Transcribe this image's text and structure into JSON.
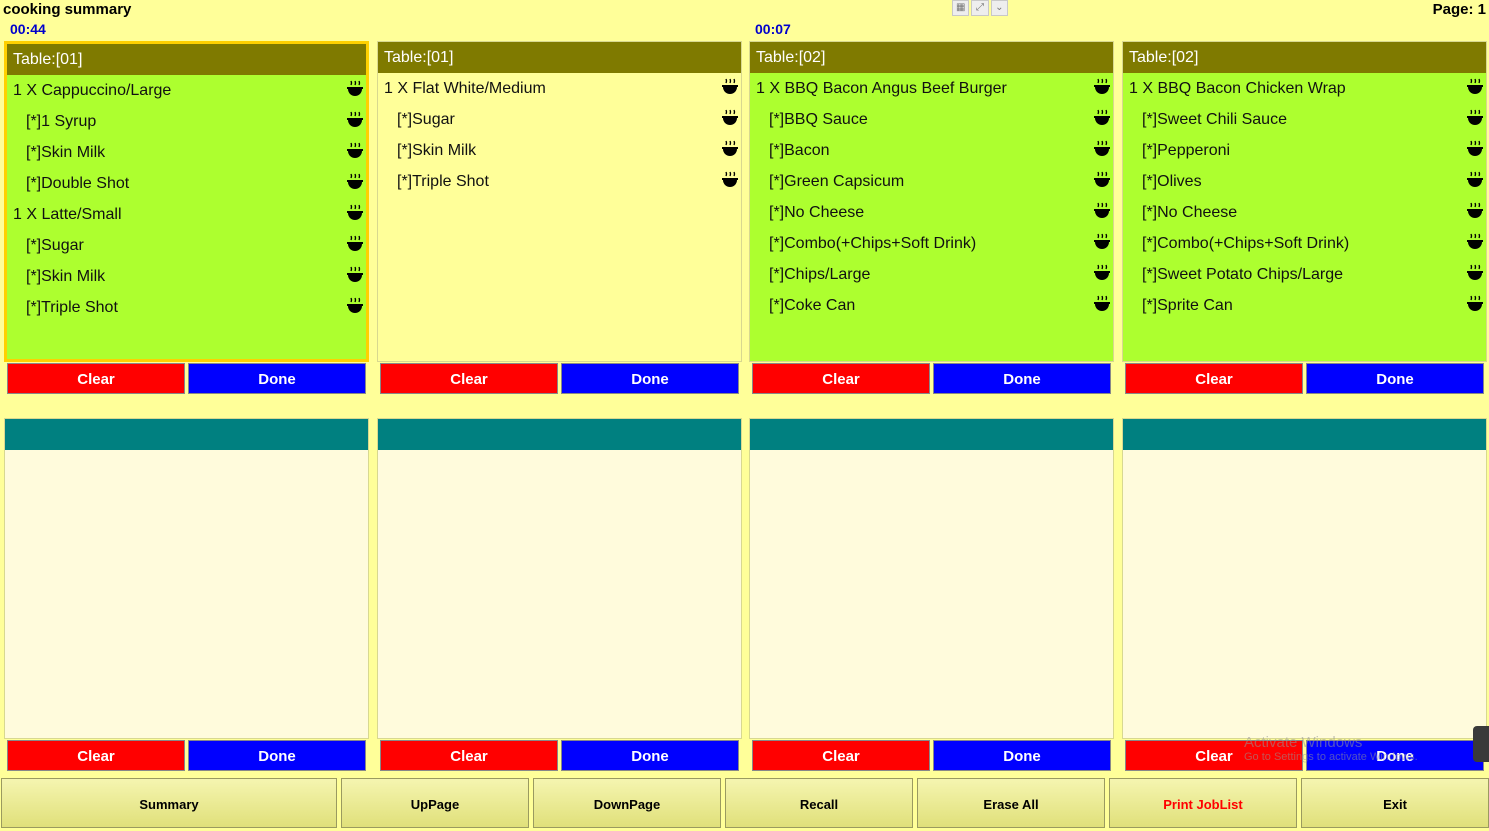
{
  "header": {
    "title": "cooking summary",
    "page_label": "Page:  1"
  },
  "panels": [
    {
      "timer": "00:44",
      "table": "Table:[01]",
      "items": [
        "1 X  Cappuccino/Large",
        "[*]1 Syrup",
        "[*]Skin Milk",
        "[*]Double Shot",
        "1 X  Latte/Small",
        "[*]Sugar",
        "[*]Skin Milk",
        "[*]Triple Shot"
      ],
      "clear": "Clear",
      "done": "Done"
    },
    {
      "timer": "",
      "table": "Table:[01]",
      "items": [
        "1 X  Flat White/Medium",
        "[*]Sugar",
        "[*]Skin Milk",
        "[*]Triple Shot"
      ],
      "clear": "Clear",
      "done": "Done"
    },
    {
      "timer": "00:07",
      "table": "Table:[02]",
      "items": [
        "1 X  BBQ Bacon Angus Beef Burger",
        "[*]BBQ Sauce",
        "[*]Bacon",
        "[*]Green Capsicum",
        "[*]No Cheese",
        "[*]Combo(+Chips+Soft Drink)",
        "[*]Chips/Large",
        "[*]Coke Can"
      ],
      "clear": "Clear",
      "done": "Done"
    },
    {
      "timer": "",
      "table": "Table:[02]",
      "items": [
        "1 X  BBQ Bacon Chicken Wrap",
        "[*]Sweet Chili Sauce",
        "[*]Pepperoni",
        "[*]Olives",
        "[*]No Cheese",
        "[*]Combo(+Chips+Soft Drink)",
        "[*]Sweet Potato Chips/Large",
        "[*]Sprite Can"
      ],
      "clear": "Clear",
      "done": "Done"
    },
    {
      "clear": "Clear",
      "done": "Done"
    },
    {
      "clear": "Clear",
      "done": "Done"
    },
    {
      "clear": "Clear",
      "done": "Done"
    },
    {
      "clear": "Clear",
      "done": "Done"
    }
  ],
  "toolbar": {
    "summary": "Summary",
    "uppage": "UpPage",
    "downpage": "DownPage",
    "recall": "Recall",
    "erase_all": "Erase All",
    "print_joblist": "Print JobList",
    "exit": "Exit"
  },
  "watermark": {
    "line1": "Activate Windows",
    "line2": "Go to Settings to activate Windows."
  },
  "icons": {
    "item_status": "bowl-icon"
  },
  "colors": {
    "background": "#ffff99",
    "ticket_green": "#adff2f",
    "ticket_yellow": "#ffff99",
    "ticket_header": "#7f7a00",
    "empty_header": "#008080",
    "clear_button": "#ff0000",
    "done_button": "#0000ff",
    "timer": "#0000cc"
  }
}
